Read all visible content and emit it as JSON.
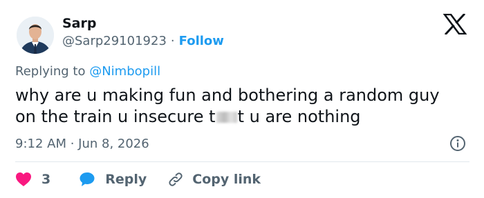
{
  "author": {
    "name": "Sarp",
    "handle": "@Sarp29101923",
    "separator": "·",
    "follow_label": "Follow"
  },
  "reply_context": {
    "prefix": "Replying to",
    "mention": "@Nimbopill"
  },
  "tweet": {
    "line1": "why are u making fun and bothering a random guy",
    "line2_before": "on the train u insecure t",
    "line2_after": "t u are nothing"
  },
  "meta": {
    "timestamp": "9:12 AM · Jun 8, 2026"
  },
  "actions": {
    "like_count": "3",
    "reply_label": "Reply",
    "copy_link_label": "Copy link"
  },
  "colors": {
    "accent": "#1d9bf0",
    "like": "#f91880",
    "secondary_text": "#536471",
    "primary_text": "#0f1419"
  },
  "icons": [
    "x-logo-icon",
    "info-icon",
    "heart-icon",
    "reply-bubble-icon",
    "link-icon"
  ]
}
